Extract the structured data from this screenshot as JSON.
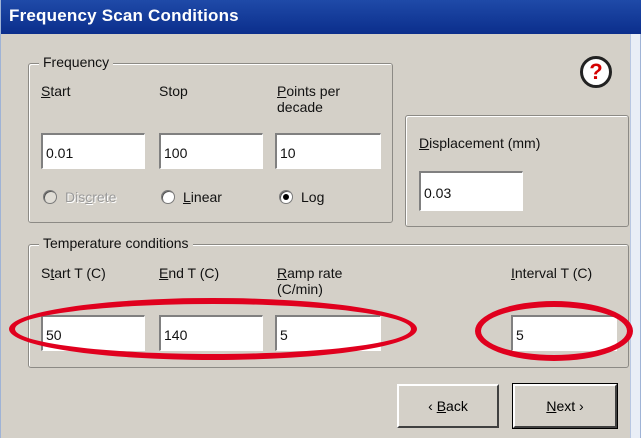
{
  "window": {
    "title": "Frequency Scan Conditions"
  },
  "frequency": {
    "group_label": "Frequency",
    "start_label_u": "S",
    "start_label_rest": "tart",
    "stop_label": "Stop",
    "points_label_u": "P",
    "points_label_rest": "oints per",
    "points_label_line2": "decade",
    "start_value": "0.01",
    "stop_value": "100",
    "points_value": "10",
    "modes": {
      "discrete_pre": "Dis",
      "discrete_u": "c",
      "discrete_post": "rete",
      "linear_u": "L",
      "linear_rest": "inear",
      "log_pre": "Lo",
      "log_u": "g",
      "selected": "Log"
    }
  },
  "displacement": {
    "label_u": "D",
    "label_rest": "isplacement (mm)",
    "value": "0.03"
  },
  "temperature": {
    "group_label": "Temperature conditions",
    "start_pre": "S",
    "start_u": "t",
    "start_rest": "art T (C)",
    "end_u": "E",
    "end_rest": "nd T (C)",
    "ramp_u": "R",
    "ramp_rest": "amp rate",
    "ramp_line2": "(C/min)",
    "interval_u": "I",
    "interval_rest": "nterval T (C)",
    "start_value": "50",
    "end_value": "140",
    "ramp_value": "5",
    "interval_value": "5"
  },
  "buttons": {
    "back_arrow": "‹",
    "back_u": "B",
    "back_rest": "ack",
    "next_u": "N",
    "next_rest": "ext",
    "next_arrow": "›"
  },
  "help": {
    "icon": "question-icon",
    "glyph": "?"
  },
  "annotation_color": "#e0001e"
}
